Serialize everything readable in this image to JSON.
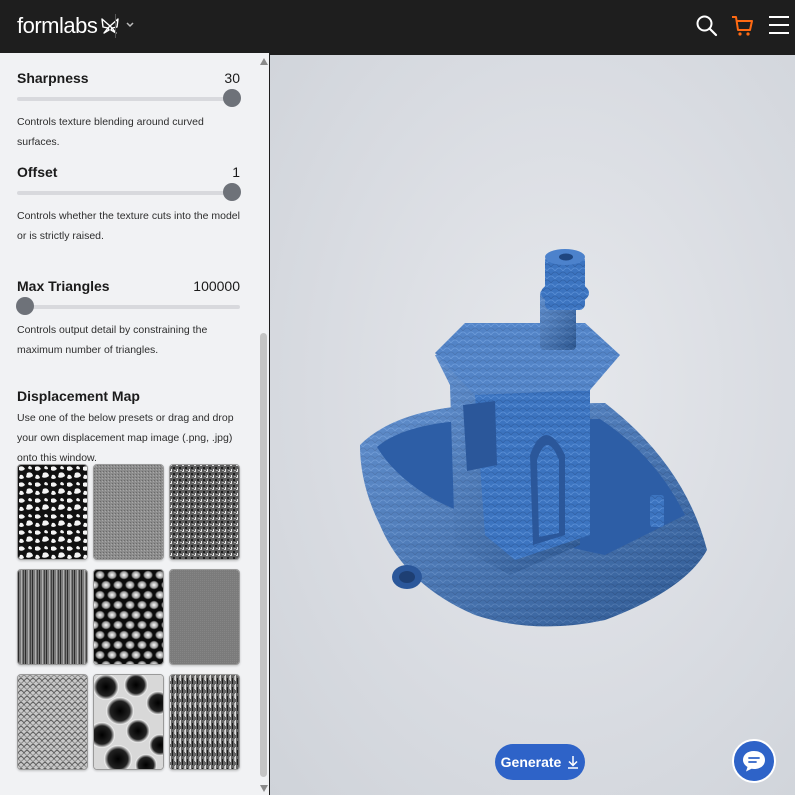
{
  "header": {
    "logo_text": "formlabs",
    "icons": [
      "butterfly-logo-icon",
      "chevron-down-icon",
      "search-icon",
      "cart-icon",
      "menu-icon"
    ],
    "accent_color": "#ff6a13"
  },
  "settings": [
    {
      "title": "Sharpness",
      "value": "30",
      "level": 1.0,
      "description": "Controls texture blending around curved surfaces."
    },
    {
      "title": "Offset",
      "value": "1",
      "level": 1.0,
      "description": "Controls whether the texture cuts into the model or is strictly raised."
    },
    {
      "title": "Max Triangles",
      "value": "100000",
      "level": 0.0,
      "description": "Controls output detail by constraining the maximum number of triangles."
    }
  ],
  "displacement": {
    "title": "Displacement Map",
    "description": "Use one of the below presets or drag and drop your own displacement map image (.png, .jpg) onto this window.",
    "presets": [
      "camo-texture",
      "fine-noise-texture",
      "gravel-texture",
      "wood-grain-texture",
      "hex-bubbles-texture",
      "flat-fine-texture",
      "scales-texture",
      "voronoi-cells-texture",
      "bark-texture"
    ]
  },
  "viewport": {
    "model_color": "#3c74c0",
    "generate_label": "Generate"
  },
  "colors": {
    "brand_blue": "#2e63c8",
    "header_bg": "#1e1e1e"
  }
}
